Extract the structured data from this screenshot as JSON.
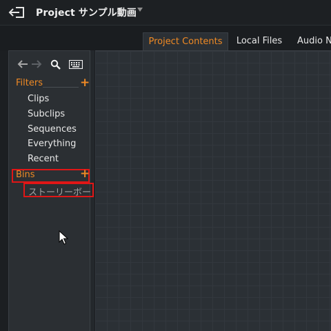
{
  "header": {
    "project_title": "Project サンプル動画"
  },
  "tabs": [
    {
      "label": "Project Contents",
      "active": true
    },
    {
      "label": "Local Files",
      "active": false
    },
    {
      "label": "Audio N",
      "active": false
    }
  ],
  "browser": {
    "filters_label": "Filters",
    "filters": [
      "Clips",
      "Subclips",
      "Sequences",
      "Everything",
      "Recent"
    ],
    "bins_label": "Bins",
    "bins": [
      "ストーリーボード"
    ],
    "add_symbol": "+"
  },
  "colors": {
    "accent": "#f08a24",
    "highlight_box": "#e11616",
    "panel": "#2b2f33",
    "grid": "#2b3035"
  },
  "icons": [
    "exit-icon",
    "back-arrow-icon",
    "forward-arrow-icon",
    "search-icon",
    "keyboard-icon",
    "add-icon",
    "mouse-cursor-icon"
  ]
}
